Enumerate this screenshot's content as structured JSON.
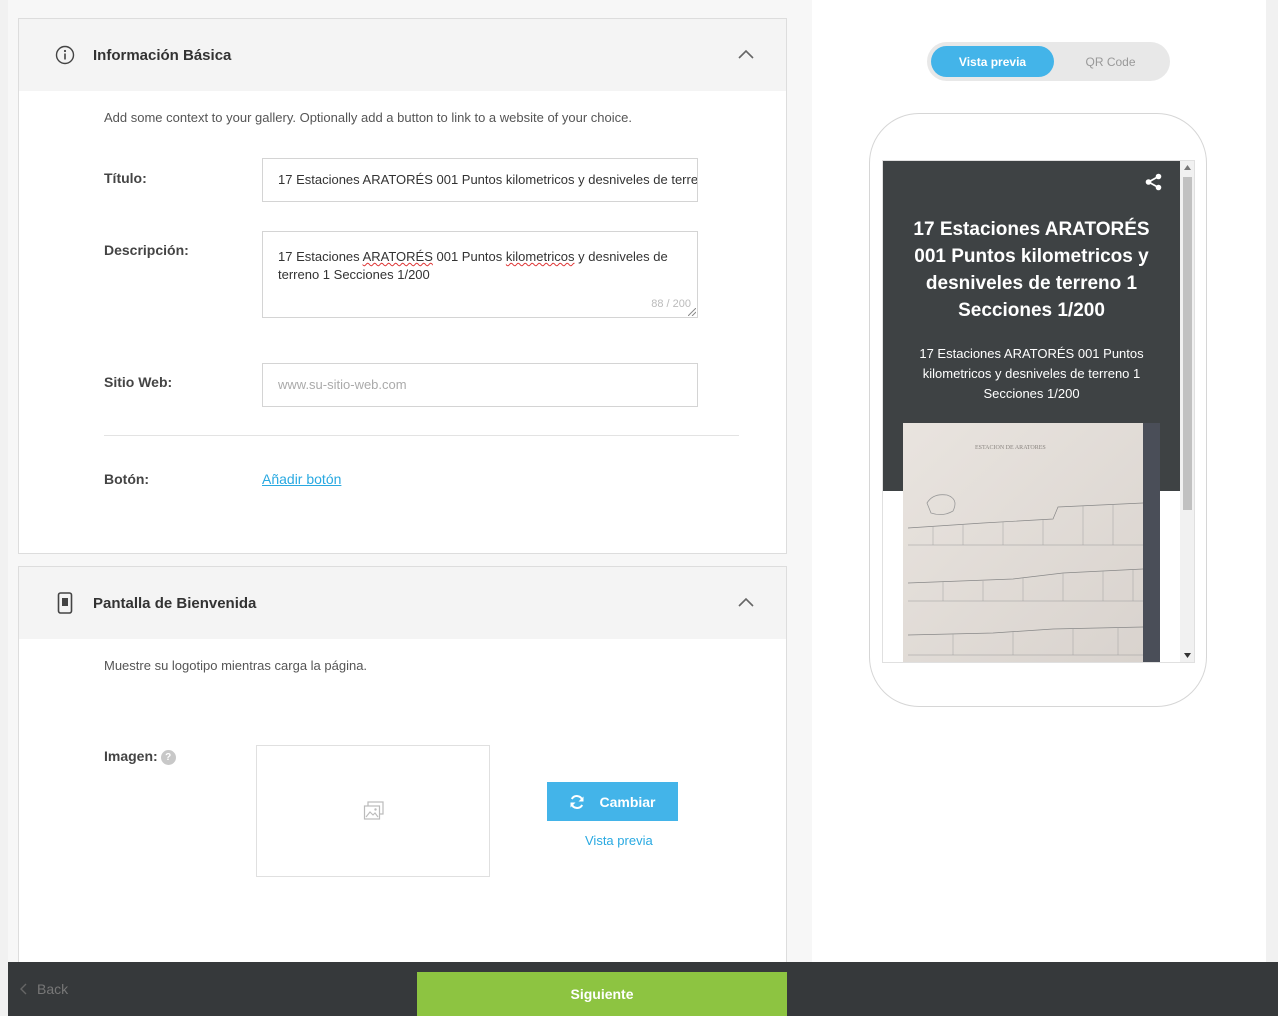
{
  "basic_info": {
    "title": "Información Básica",
    "description": "Add some context to your gallery. Optionally add a button to link to a website of your choice.",
    "title_label": "Título:",
    "title_value": "17  Estaciones ARATORÉS 001 Puntos kilometricos y desniveles de terreno 1    Secciones  1/200",
    "description_label": "Descripción:",
    "description_value_parts": [
      "17  Estaciones ",
      "ARATORÉS",
      " 001 Puntos ",
      "kilometricos",
      " y desniveles de terreno 1    Secciones  1/200"
    ],
    "char_counter": "88 / 200",
    "website_label": "Sitio Web:",
    "website_placeholder": "www.su-sitio-web.com",
    "button_label": "Botón:",
    "add_button_link": "Añadir botón"
  },
  "welcome_screen": {
    "title": "Pantalla de Bienvenida",
    "description": "Muestre su logotipo mientras carga la página.",
    "image_label": "Imagen:",
    "help_glyph": "?",
    "change_button": "Cambiar",
    "preview_link": "Vista previa"
  },
  "preview": {
    "toggle_active": "Vista previa",
    "toggle_inactive": "QR Code",
    "hero_title": "17 Estaciones ARATORÉS 001 Puntos kilometricos y desniveles de terreno 1 Secciones 1/200",
    "hero_description": "17 Estaciones ARATORÉS 001 Puntos kilometricos y desniveles de terreno 1 Secciones 1/200",
    "photo_caption": "ESTACION DE ARATORES"
  },
  "footer": {
    "back": "Back",
    "next": "Siguiente"
  },
  "colors": {
    "accent_blue": "#43b4e9",
    "link_blue": "#29a9e1",
    "next_green": "#8dc441",
    "footer_dark": "#36393b",
    "hero_dark": "#3e4244"
  }
}
